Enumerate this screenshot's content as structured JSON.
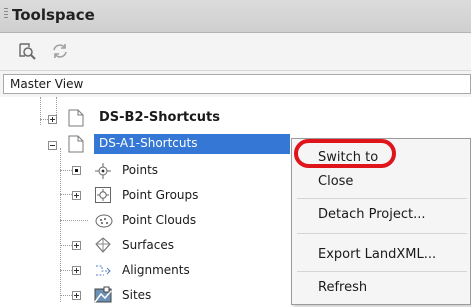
{
  "window": {
    "title": "Toolspace"
  },
  "toolbar": {
    "icons": [
      "find-icon",
      "refresh-icon"
    ]
  },
  "view_selector": {
    "value": "Master View"
  },
  "tree": {
    "items": [
      {
        "label": "DS-B2-Shortcuts",
        "bold": true,
        "expander": "plus",
        "icon": "project-folder-icon"
      },
      {
        "label": "DS-A1-Shortcuts",
        "selected": true,
        "expander": "minus",
        "icon": "project-folder-icon"
      },
      {
        "label": "Points",
        "expander": "bullet",
        "icon": "points-icon"
      },
      {
        "label": "Point Groups",
        "expander": "plus",
        "icon": "point-groups-icon"
      },
      {
        "label": "Point Clouds",
        "expander": "none",
        "icon": "point-clouds-icon"
      },
      {
        "label": "Surfaces",
        "expander": "plus",
        "icon": "surfaces-icon"
      },
      {
        "label": "Alignments",
        "expander": "plus",
        "icon": "alignments-icon"
      },
      {
        "label": "Sites",
        "expander": "plus",
        "icon": "sites-icon"
      }
    ]
  },
  "context_menu": {
    "items": [
      {
        "label": "Switch to",
        "highlighted": true
      },
      {
        "label": "Close"
      },
      {
        "label": "Detach Project..."
      },
      {
        "label": "Export LandXML..."
      },
      {
        "label": "Refresh"
      }
    ],
    "highlight_color": "#e0141b"
  },
  "colors": {
    "selection": "#3477d4",
    "titlebar": "#d6d6d6"
  }
}
